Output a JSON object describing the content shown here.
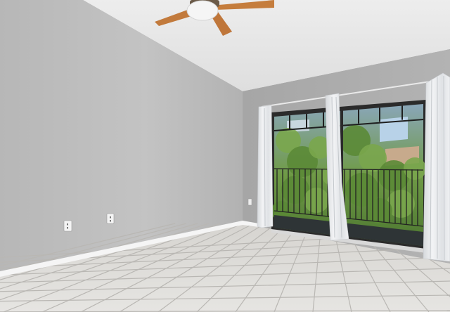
{
  "scene": {
    "subject": "empty-room-interior",
    "colors": {
      "left_wall_light": "#c9c9c9",
      "left_wall_dark": "#a9a9a9",
      "back_wall_light": "#b9b9b9",
      "back_wall_dark": "#a4a4a4",
      "ceiling": "#e4e4e4",
      "floor": "#e2e1de",
      "tile_grout": "#b8b6b2",
      "baseboard": "#f4f4f4",
      "curtain": "#eef0f2",
      "curtain_shadow": "#c8cbcf",
      "door_frame": "#2a2a2a",
      "foliage": "#5f8a3a",
      "sky": "#b9d3ea",
      "fan_blade": "#c57d3d",
      "fan_light": "#f6f6f6"
    }
  }
}
